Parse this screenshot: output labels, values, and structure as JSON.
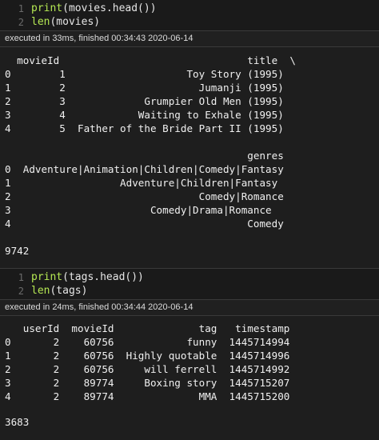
{
  "cell1": {
    "line_numbers": [
      "1",
      "2"
    ],
    "code_line1_fn": "print",
    "code_line1_rest": "(movies.head())",
    "code_line2_fn": "len",
    "code_line2_rest": "(movies)"
  },
  "exec1": "executed in 33ms, finished 00:34:43 2020-06-14",
  "out1": [
    "  movieId                               title  \\",
    "0        1                    Toy Story (1995)   ",
    "1        2                      Jumanji (1995)   ",
    "2        3             Grumpier Old Men (1995)   ",
    "3        4            Waiting to Exhale (1995)   ",
    "4        5  Father of the Bride Part II (1995)   ",
    "",
    "                                        genres  ",
    "0  Adventure|Animation|Children|Comedy|Fantasy  ",
    "1                  Adventure|Children|Fantasy  ",
    "2                               Comedy|Romance  ",
    "3                       Comedy|Drama|Romance  ",
    "4                                       Comedy  ",
    "",
    "9742"
  ],
  "cell2": {
    "line_numbers": [
      "1",
      "2"
    ],
    "code_line1_fn": "print",
    "code_line1_rest": "(tags.head())",
    "code_line2_fn": "len",
    "code_line2_rest": "(tags)"
  },
  "exec2": "executed in 24ms, finished 00:34:44 2020-06-14",
  "out2": [
    "   userId  movieId              tag   timestamp",
    "0       2    60756            funny  1445714994",
    "1       2    60756  Highly quotable  1445714996",
    "2       2    60756     will ferrell  1445714992",
    "3       2    89774     Boxing story  1445715207",
    "4       2    89774              MMA  1445715200",
    "",
    "3683"
  ]
}
